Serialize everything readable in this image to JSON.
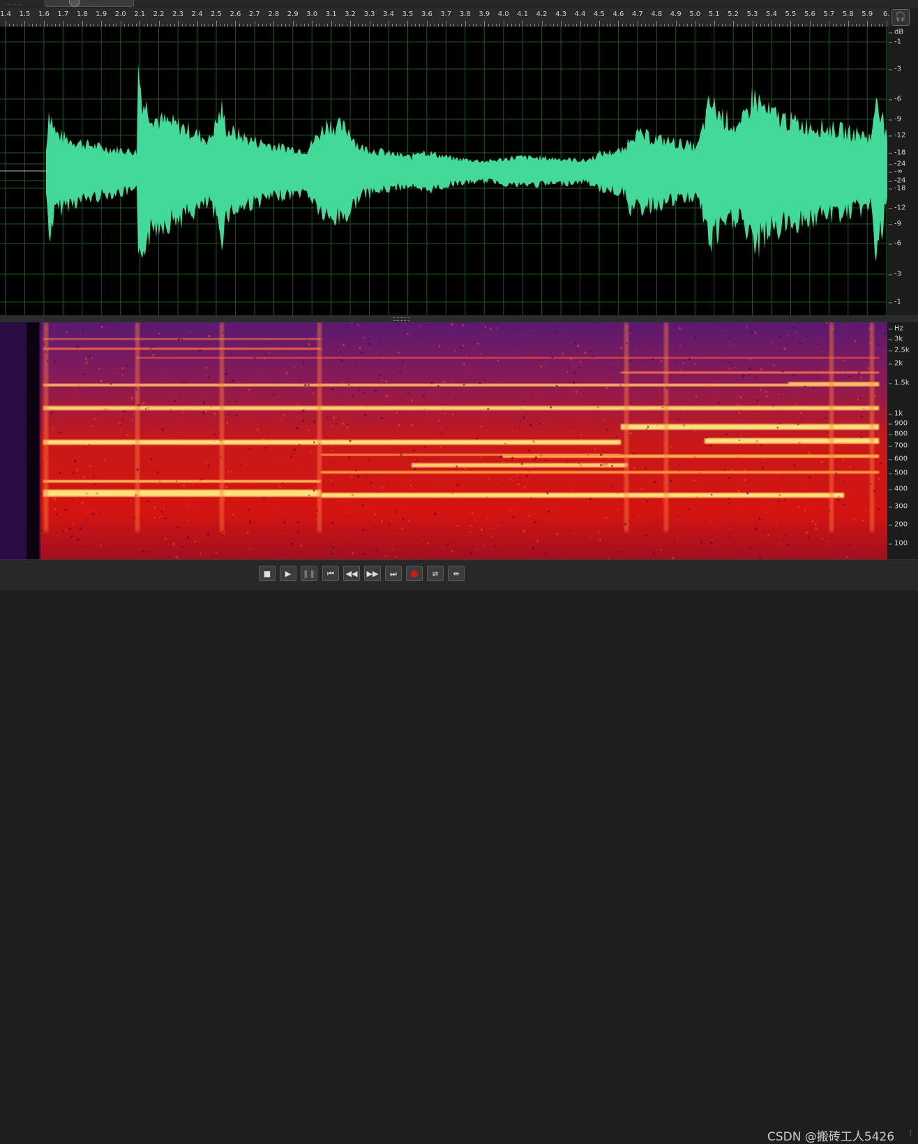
{
  "ruler": {
    "ticks": [
      "1.4",
      "1.5",
      "1.6",
      "1.7",
      "1.8",
      "1.9",
      "2.0",
      "2.1",
      "2.2",
      "2.3",
      "2.4",
      "2.5",
      "2.6",
      "2.7",
      "2.8",
      "2.9",
      "3.0",
      "3.1",
      "3.2",
      "3.3",
      "3.4",
      "3.5",
      "3.6",
      "3.7",
      "3.8",
      "3.9",
      "4.0",
      "4.1",
      "4.2",
      "4.3",
      "4.4",
      "4.5",
      "4.6",
      "4.7",
      "4.8",
      "4.9",
      "5.0",
      "5.1",
      "5.2",
      "5.3",
      "5.4",
      "5.5",
      "5.6",
      "5.7",
      "5.8",
      "5.9",
      "6."
    ]
  },
  "db_scale": {
    "labels": [
      "dB",
      "-1",
      "-3",
      "-6",
      "-9",
      "-12",
      "-18",
      "-24",
      "-∞",
      "-24",
      "-18",
      "-12",
      "-9",
      "-6",
      "-3",
      "-1"
    ]
  },
  "hz_scale": {
    "labels": [
      "Hz",
      "3k",
      "2.5k",
      "2k",
      "1.5k",
      "1k",
      "900",
      "800",
      "700",
      "600",
      "500",
      "400",
      "300",
      "200",
      "100"
    ]
  },
  "transport": {
    "buttons": [
      {
        "name": "stop-button",
        "glyph": "■"
      },
      {
        "name": "play-button",
        "glyph": "▶"
      },
      {
        "name": "pause-button",
        "glyph": "❚❚"
      },
      {
        "name": "move-to-previous-button",
        "glyph": "⏮"
      },
      {
        "name": "rewind-button",
        "glyph": "◀◀"
      },
      {
        "name": "fast-forward-button",
        "glyph": "▶▶"
      },
      {
        "name": "move-to-next-button",
        "glyph": "⏭"
      },
      {
        "name": "record-button",
        "glyph": "●"
      },
      {
        "name": "loop-playback-button",
        "glyph": "⮂"
      },
      {
        "name": "skip-selection-button",
        "glyph": "⇹"
      }
    ]
  },
  "watermark": "CSDN @搬砖工人5426",
  "colors": {
    "waveform": "#42d999",
    "grid": "#1a5a1a",
    "spectral_background": "#3a1060",
    "spectral_hot": "#ffe27a"
  },
  "icons": {
    "headphone": "headphone-icon"
  }
}
